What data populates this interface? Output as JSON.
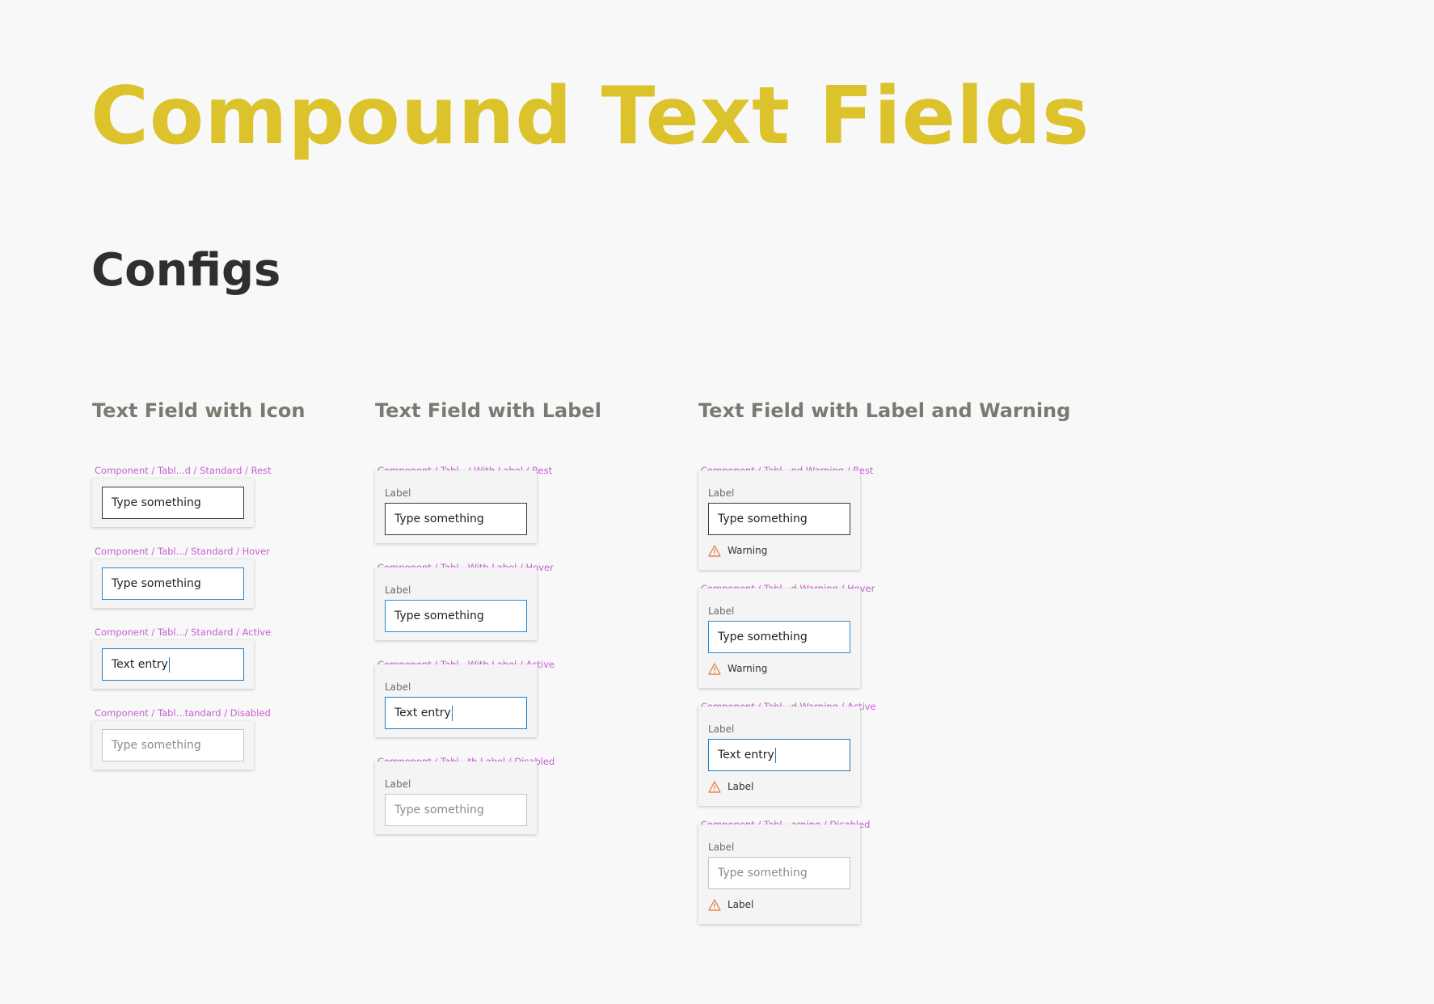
{
  "page": {
    "title": "Compound Text Fields",
    "subtitle": "Configs"
  },
  "columns": [
    {
      "title": "Text Field with Icon",
      "items": [
        {
          "component": "Component / Tabl...d / Standard / Rest",
          "value": "Type something"
        },
        {
          "component": "Component / Tabl.../ Standard / Hover",
          "value": "Type something"
        },
        {
          "component": "Component / Tabl.../ Standard / Active",
          "value": "Text entry"
        },
        {
          "component": "Component / Tabl...tandard / Disabled",
          "value": "Type something"
        }
      ]
    },
    {
      "title": "Text Field with Label",
      "items": [
        {
          "component": "Component / Tabl.../ With Label / Rest",
          "label": "Label",
          "value": "Type something"
        },
        {
          "component": "Component / Tabl...With Label / Hover",
          "label": "Label",
          "value": "Type something"
        },
        {
          "component": "Component / Tabl...With Label / Active",
          "label": "Label",
          "value": "Text entry"
        },
        {
          "component": "Component / Tabl...th Label / Disabled",
          "label": "Label",
          "value": "Type something"
        }
      ]
    },
    {
      "title": "Text Field with Label and Warning",
      "items": [
        {
          "component": "Component / Tabl...nd Warning / Rest",
          "label": "Label",
          "value": "Type something",
          "warning": "Warning"
        },
        {
          "component": "Component / Tabl...d Warning / Hover",
          "label": "Label",
          "value": "Type something",
          "warning": "Warning"
        },
        {
          "component": "Component / Tabl...d Warning / Active",
          "label": "Label",
          "value": "Text entry",
          "warning": "Label"
        },
        {
          "component": "Component / Tabl...arning / Disabled",
          "label": "Label",
          "value": "Type something",
          "warning": "Label"
        }
      ]
    }
  ],
  "icons": {
    "warning": "warning-triangle-icon"
  },
  "colors": {
    "title": "#dcc32c",
    "heading": "#2f2f2f",
    "column_title": "#7a7a72",
    "component_name": "#c75fd4",
    "field_rest_border": "#3a3a3a",
    "field_focus_border": "#1f7ac0",
    "field_disabled_border": "#c4c4c4",
    "warning_icon": "#e8743b"
  }
}
